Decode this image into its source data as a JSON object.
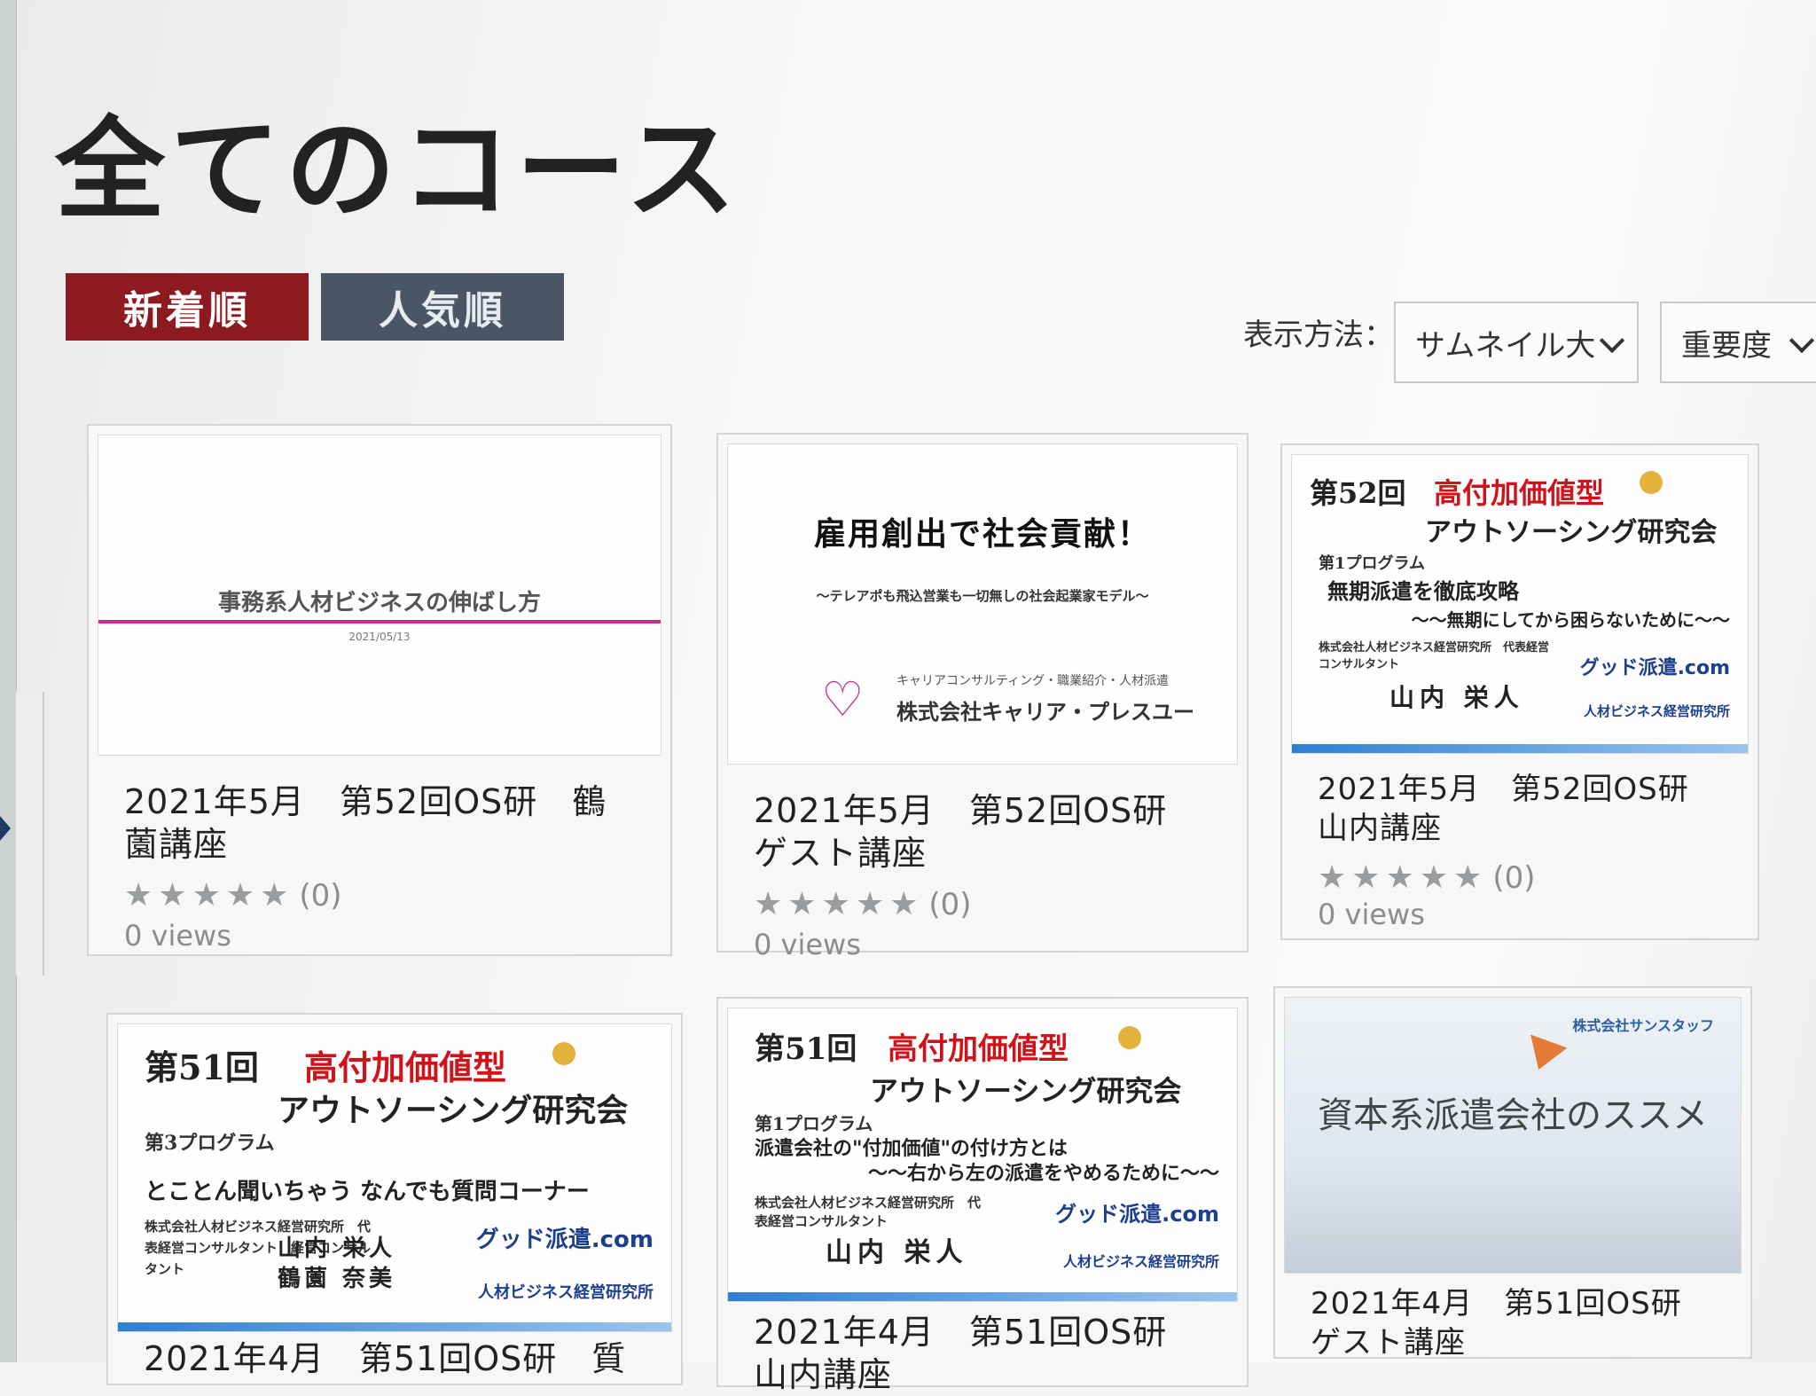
{
  "page": {
    "title": "全てのコース"
  },
  "sort_tabs": {
    "newest": "新着順",
    "popular": "人気順"
  },
  "display": {
    "label": "表示方法：",
    "view_selected": "サムネイル大",
    "order_selected": "重要度"
  },
  "courses": [
    {
      "title": "2021年5月　第52回OS研　鶴薗講座",
      "rating_count": "(0)",
      "views": "0 views",
      "thumb": {
        "title": "事務系人材ビジネスの伸ばし方",
        "date": "2021/05/13"
      }
    },
    {
      "title": "2021年5月　第52回OS研　ゲスト講座",
      "rating_count": "(0)",
      "views": "0 views",
      "thumb": {
        "title": "雇用創出で社会貢献！",
        "subtitle": "～テレアポも飛込営業も一切無しの社会起業家モデル～",
        "tagline": "キャリアコンサルティング・職業紹介・人材派遣",
        "company": "株式会社キャリア・プレスユー"
      }
    },
    {
      "title": "2021年5月　第52回OS研　山内講座",
      "rating_count": "(0)",
      "views": "0 views",
      "thumb": {
        "round": "第52回",
        "highlight": "高付加価値型",
        "heading": "アウトソーシング研究会",
        "program": "第1プログラム",
        "topic": "無期派遣を徹底攻略",
        "subtopic": "～～無期にしてから困らないために～～",
        "org": "株式会社人材ビジネス経営研究所　代表経営コンサルタント",
        "person": "山内 栄人",
        "logo1": "グッド派遣.com",
        "logo2": "人材ビジネス経営研究所"
      }
    },
    {
      "title": "2021年4月　第51回OS研　質",
      "rating_count": "",
      "views": "",
      "thumb": {
        "round": "第51回",
        "highlight": "高付加価値型",
        "heading": "アウトソーシング研究会",
        "program": "第3プログラム",
        "topic": "とことん聞いちゃう なんでも質問コーナー",
        "org": "株式会社人材ビジネス経営研究所　代表経営コンサルタント　経営コンサルタント",
        "person": "山内 栄人　鶴薗 奈美",
        "logo1": "グッド派遣.com",
        "logo2": "人材ビジネス経営研究所"
      }
    },
    {
      "title": "2021年4月　第51回OS研　山内講座",
      "rating_count": "",
      "views": "",
      "thumb": {
        "round": "第51回",
        "highlight": "高付加価値型",
        "heading": "アウトソーシング研究会",
        "program": "第1プログラム",
        "topic": "派遣会社の\"付加価値\"の付け方とは",
        "subtopic": "～～右から左の派遣をやめるために～～",
        "org": "株式会社人材ビジネス経営研究所　代表経営コンサルタント",
        "person": "山内 栄人",
        "logo1": "グッド派遣.com",
        "logo2": "人材ビジネス経営研究所"
      }
    },
    {
      "title": "2021年4月　第51回OS研　ゲスト講座",
      "rating_count": "",
      "views": "",
      "thumb": {
        "title": "資本系派遣会社のススメ",
        "brand": "株式会社サンスタッフ"
      }
    }
  ],
  "icons": {
    "star": "star-icon",
    "chevron": "chevron-down-icon"
  },
  "colors": {
    "newest_tab": "#8c1a1f",
    "popular_tab": "#4a5566",
    "flyer_red": "#d0121b"
  }
}
